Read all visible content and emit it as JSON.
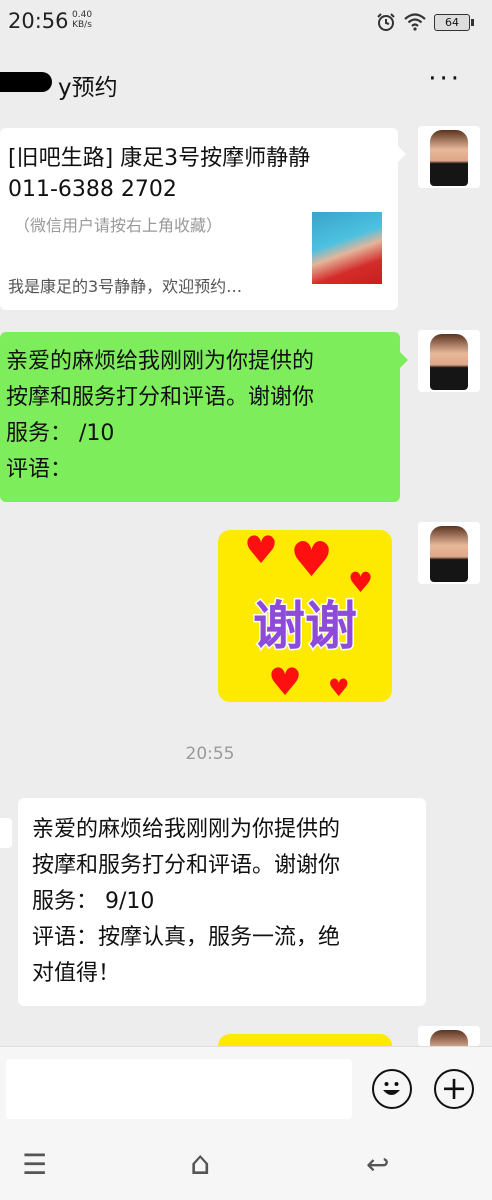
{
  "status": {
    "time": "20:56",
    "speed_value": "0.40",
    "speed_unit": "KB/s",
    "battery": "64",
    "icons": [
      "alarm-icon",
      "wifi-icon",
      "battery-icon"
    ]
  },
  "header": {
    "title": "y预约",
    "more": "···"
  },
  "messages": {
    "card": {
      "title_line1": "[旧吧生路] 康足3号按摩师静静",
      "title_line2": "011-6388 2702",
      "hint": "（微信用户请按右上角收藏）",
      "description": "我是康足的3号静静，欢迎预约…"
    },
    "green": {
      "line1": "亲爱的麻烦给我刚刚为你提供的",
      "line2": "按摩和服务打分和评语。谢谢你",
      "line3": "服务：  /10",
      "line4": "评语："
    },
    "sticker": {
      "text": "谢谢"
    },
    "timestamp": "20:55",
    "reply": {
      "line1": "亲爱的麻烦给我刚刚为你提供的",
      "line2": "按摩和服务打分和评语。谢谢你",
      "line3": "服务：  9/10",
      "line4": "评语：按摩认真，服务一流，绝",
      "line5": "对值得！"
    }
  },
  "input": {
    "emoji": "☺",
    "plus": "+"
  },
  "navbar": {
    "menu": "☰",
    "home": "⌂",
    "back": "↩"
  },
  "colors": {
    "background": "#ededed",
    "green_bubble": "#7ded5b",
    "sticker": "#fdea00"
  }
}
